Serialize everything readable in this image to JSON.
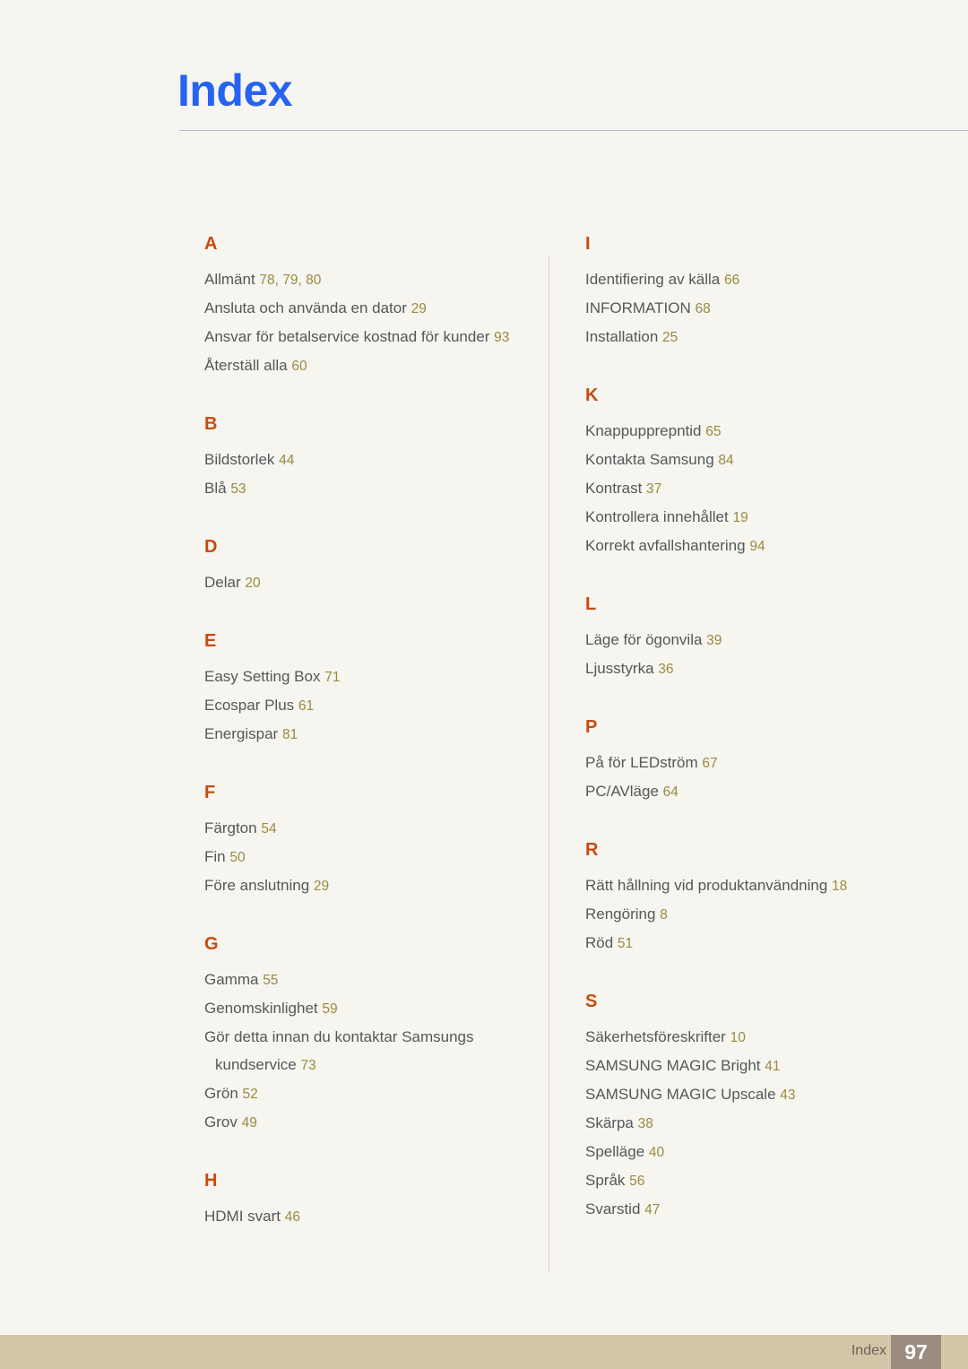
{
  "header": {
    "title": "Index"
  },
  "footer": {
    "label": "Index",
    "page_number": "97"
  },
  "colors": {
    "background": "#f6f5ef",
    "title": "#2563f0",
    "letter_heading": "#c84a10",
    "entry_text": "#54585a",
    "page_ref": "#9a8a41",
    "header_rule": "#b9b6d6",
    "column_divider": "#e4cfc7",
    "footer_bar": "#d3c6a8",
    "footer_page_box": "#9a8d80",
    "footer_page_text": "#ffffff",
    "footer_label": "#6a6158"
  },
  "columns": [
    {
      "name": "left",
      "groups": [
        {
          "letter": "A",
          "entries": [
            {
              "term": "Allmänt",
              "pages": "78, 79, 80"
            },
            {
              "term": "Ansluta och använda en dator",
              "pages": "29"
            },
            {
              "term": "Ansvar för betalservice kostnad för kunder",
              "pages": "93"
            },
            {
              "term": "Återställ alla",
              "pages": "60"
            }
          ]
        },
        {
          "letter": "B",
          "entries": [
            {
              "term": "Bildstorlek",
              "pages": "44"
            },
            {
              "term": "Blå",
              "pages": "53"
            }
          ]
        },
        {
          "letter": "D",
          "entries": [
            {
              "term": "Delar",
              "pages": "20"
            }
          ]
        },
        {
          "letter": "E",
          "entries": [
            {
              "term": "Easy Setting Box",
              "pages": "71"
            },
            {
              "term": "Ecospar Plus",
              "pages": "61"
            },
            {
              "term": "Energispar",
              "pages": "81"
            }
          ]
        },
        {
          "letter": "F",
          "entries": [
            {
              "term": "Färgton",
              "pages": "54"
            },
            {
              "term": "Fin",
              "pages": "50"
            },
            {
              "term": "Före anslutning",
              "pages": "29"
            }
          ]
        },
        {
          "letter": "G",
          "entries": [
            {
              "term": "Gamma",
              "pages": "55"
            },
            {
              "term": "Genomskinlighet",
              "pages": "59"
            },
            {
              "term": "Gör detta innan du kontaktar Samsungs kundservice",
              "pages": "73"
            },
            {
              "term": "Grön",
              "pages": "52"
            },
            {
              "term": "Grov",
              "pages": "49"
            }
          ]
        },
        {
          "letter": "H",
          "entries": [
            {
              "term": "HDMI svart",
              "pages": "46"
            }
          ]
        }
      ]
    },
    {
      "name": "right",
      "groups": [
        {
          "letter": "I",
          "entries": [
            {
              "term": "Identifiering av källa",
              "pages": "66"
            },
            {
              "term": "INFORMATION",
              "pages": "68"
            },
            {
              "term": "Installation",
              "pages": "25"
            }
          ]
        },
        {
          "letter": "K",
          "entries": [
            {
              "term": "Knappupprepntid",
              "pages": "65"
            },
            {
              "term": "Kontakta Samsung",
              "pages": "84"
            },
            {
              "term": "Kontrast",
              "pages": "37"
            },
            {
              "term": "Kontrollera innehållet",
              "pages": "19"
            },
            {
              "term": "Korrekt avfallshantering",
              "pages": "94"
            }
          ]
        },
        {
          "letter": "L",
          "entries": [
            {
              "term": "Läge för ögonvila",
              "pages": "39"
            },
            {
              "term": "Ljusstyrka",
              "pages": "36"
            }
          ]
        },
        {
          "letter": "P",
          "entries": [
            {
              "term": "På för LEDström",
              "pages": "67"
            },
            {
              "term": "PC/AVläge",
              "pages": "64"
            }
          ]
        },
        {
          "letter": "R",
          "entries": [
            {
              "term": "Rätt hållning vid produktanvändning",
              "pages": "18"
            },
            {
              "term": "Rengöring",
              "pages": "8"
            },
            {
              "term": "Röd",
              "pages": "51"
            }
          ]
        },
        {
          "letter": "S",
          "entries": [
            {
              "term": "Säkerhetsföreskrifter",
              "pages": "10"
            },
            {
              "term": "SAMSUNG MAGIC Bright",
              "pages": "41"
            },
            {
              "term": "SAMSUNG MAGIC Upscale",
              "pages": "43"
            },
            {
              "term": "Skärpa",
              "pages": "38"
            },
            {
              "term": "Spelläge",
              "pages": "40"
            },
            {
              "term": "Språk",
              "pages": "56"
            },
            {
              "term": "Svarstid",
              "pages": "47"
            }
          ]
        }
      ]
    }
  ]
}
